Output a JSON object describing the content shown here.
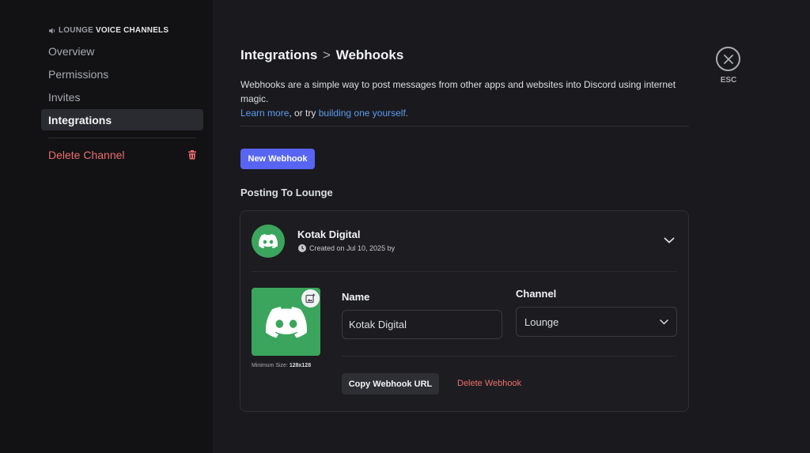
{
  "sidebar": {
    "header_muted": "LOUNGE",
    "header_bright": "VOICE CHANNELS",
    "items": [
      {
        "label": "Overview"
      },
      {
        "label": "Permissions"
      },
      {
        "label": "Invites"
      },
      {
        "label": "Integrations"
      }
    ],
    "delete_label": "Delete Channel"
  },
  "breadcrumb": {
    "parent": "Integrations",
    "separator": ">",
    "current": "Webhooks"
  },
  "description": {
    "text": "Webhooks are a simple way to post messages from other apps and websites into Discord using internet magic.",
    "learn_more": "Learn more",
    "middle": ", or try ",
    "build_link": "building one yourself."
  },
  "close": {
    "label": "ESC"
  },
  "new_webhook_label": "New Webhook",
  "section_title": "Posting To Lounge",
  "webhook": {
    "name": "Kotak Digital",
    "created": "Created on Jul 10, 2025 by",
    "min_size_prefix": "Minimum Size: ",
    "min_size_value": "128x128",
    "name_label": "Name",
    "name_value": "Kotak Digital",
    "channel_label": "Channel",
    "channel_value": "Lounge",
    "copy_label": "Copy Webhook URL",
    "delete_label": "Delete Webhook"
  },
  "colors": {
    "accent": "#5865f2",
    "avatar": "#3ba55d",
    "danger": "#ea6d6f",
    "link": "#5c9bf0"
  }
}
